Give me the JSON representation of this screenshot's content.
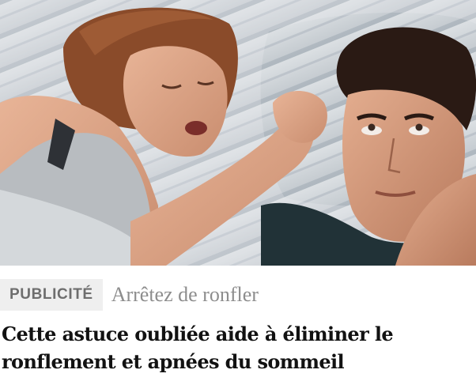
{
  "ad": {
    "image_alt": "Femme qui ronfle à côté d'un homme qui se bouche les oreilles avec un oreiller",
    "sponsor_label": "PUBLICITÉ",
    "advertiser": "Arrêtez de ronfler",
    "headline": "Cette astuce oubliée aide à éliminer le ronflement et apnées du sommeil"
  },
  "colors": {
    "badge_bg": "#efefef",
    "badge_text": "#6e6e6e",
    "advertiser_text": "#8d8d8d",
    "headline_text": "#121212"
  }
}
